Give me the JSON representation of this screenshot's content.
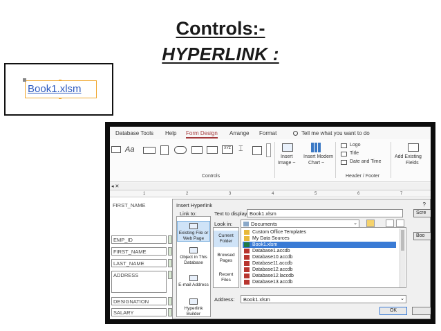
{
  "slide": {
    "title": "Controls:-",
    "subtitle": "HYPERLINK :"
  },
  "control_preview": {
    "link_text": "Book1.xlsm"
  },
  "ribbon": {
    "tabs": [
      "Database Tools",
      "Help",
      "Form Design",
      "Arrange",
      "Format"
    ],
    "active_tab": "Form Design",
    "tell_me": "Tell me what you want to do",
    "controls_label": "Controls",
    "header_footer_label": "Header / Footer",
    "aa_glyph": "Aa",
    "xyz_glyph": "XYZ",
    "insert_image": [
      "Insert",
      "Image ~"
    ],
    "insert_modern_chart": [
      "Insert Modern",
      "Chart ~"
    ],
    "logo_label": "Logo",
    "title_label": "Title",
    "date_time_label": "Date and Time",
    "add_existing_fields": [
      "Add Existing",
      "Fields"
    ],
    "accent_color": "#a4373a"
  },
  "ruler": {
    "ticks": [
      "1",
      "2",
      "3",
      "4",
      "5",
      "6",
      "7"
    ]
  },
  "form": {
    "labels": [
      "FIRST_NAME",
      "EMP_ID",
      "FIRST_NAME",
      "LAST_NAME",
      "ADDRESS",
      "DESIGNATION",
      "SALARY"
    ]
  },
  "dialog": {
    "title": "Insert Hyperlink",
    "help": "?",
    "link_to_label": "Link to:",
    "text_to_display_label": "Text to display:",
    "text_to_display_value": "Book1.xlsm",
    "screentip_button": "Scre",
    "look_in_label": "Look in:",
    "look_in_value": "Documents",
    "bookmark_button": "Boo",
    "link_to_items": [
      {
        "label": "Existing File or Web Page",
        "icon": "globe-file-icon",
        "selected": true
      },
      {
        "label": "Object in This Database",
        "icon": "database-object-icon",
        "selected": false
      },
      {
        "label": "E-mail Address",
        "icon": "email-icon",
        "selected": false
      },
      {
        "label": "Hyperlink Builder",
        "icon": "builder-icon",
        "selected": false
      }
    ],
    "nav_items": [
      {
        "label": "Current Folder",
        "selected": true
      },
      {
        "label": "Browsed Pages",
        "selected": false
      },
      {
        "label": "Recent Files",
        "selected": false
      }
    ],
    "files": [
      {
        "name": "Custom Office Templates",
        "type": "folder",
        "selected": false
      },
      {
        "name": "My Data Sources",
        "type": "folder",
        "selected": false
      },
      {
        "name": "Book1.xlsm",
        "type": "xls",
        "selected": true
      },
      {
        "name": "Database1.accdb",
        "type": "db",
        "selected": false
      },
      {
        "name": "Database10.accdb",
        "type": "db",
        "selected": false
      },
      {
        "name": "Database11.accdb",
        "type": "db",
        "selected": false
      },
      {
        "name": "Database12.accdb",
        "type": "db",
        "selected": false
      },
      {
        "name": "Database12.laccdb",
        "type": "db",
        "selected": false
      },
      {
        "name": "Database13.accdb",
        "type": "db",
        "selected": false
      }
    ],
    "address_label": "Address:",
    "address_value": "Book1.xlsm",
    "ok_button": "OK"
  }
}
